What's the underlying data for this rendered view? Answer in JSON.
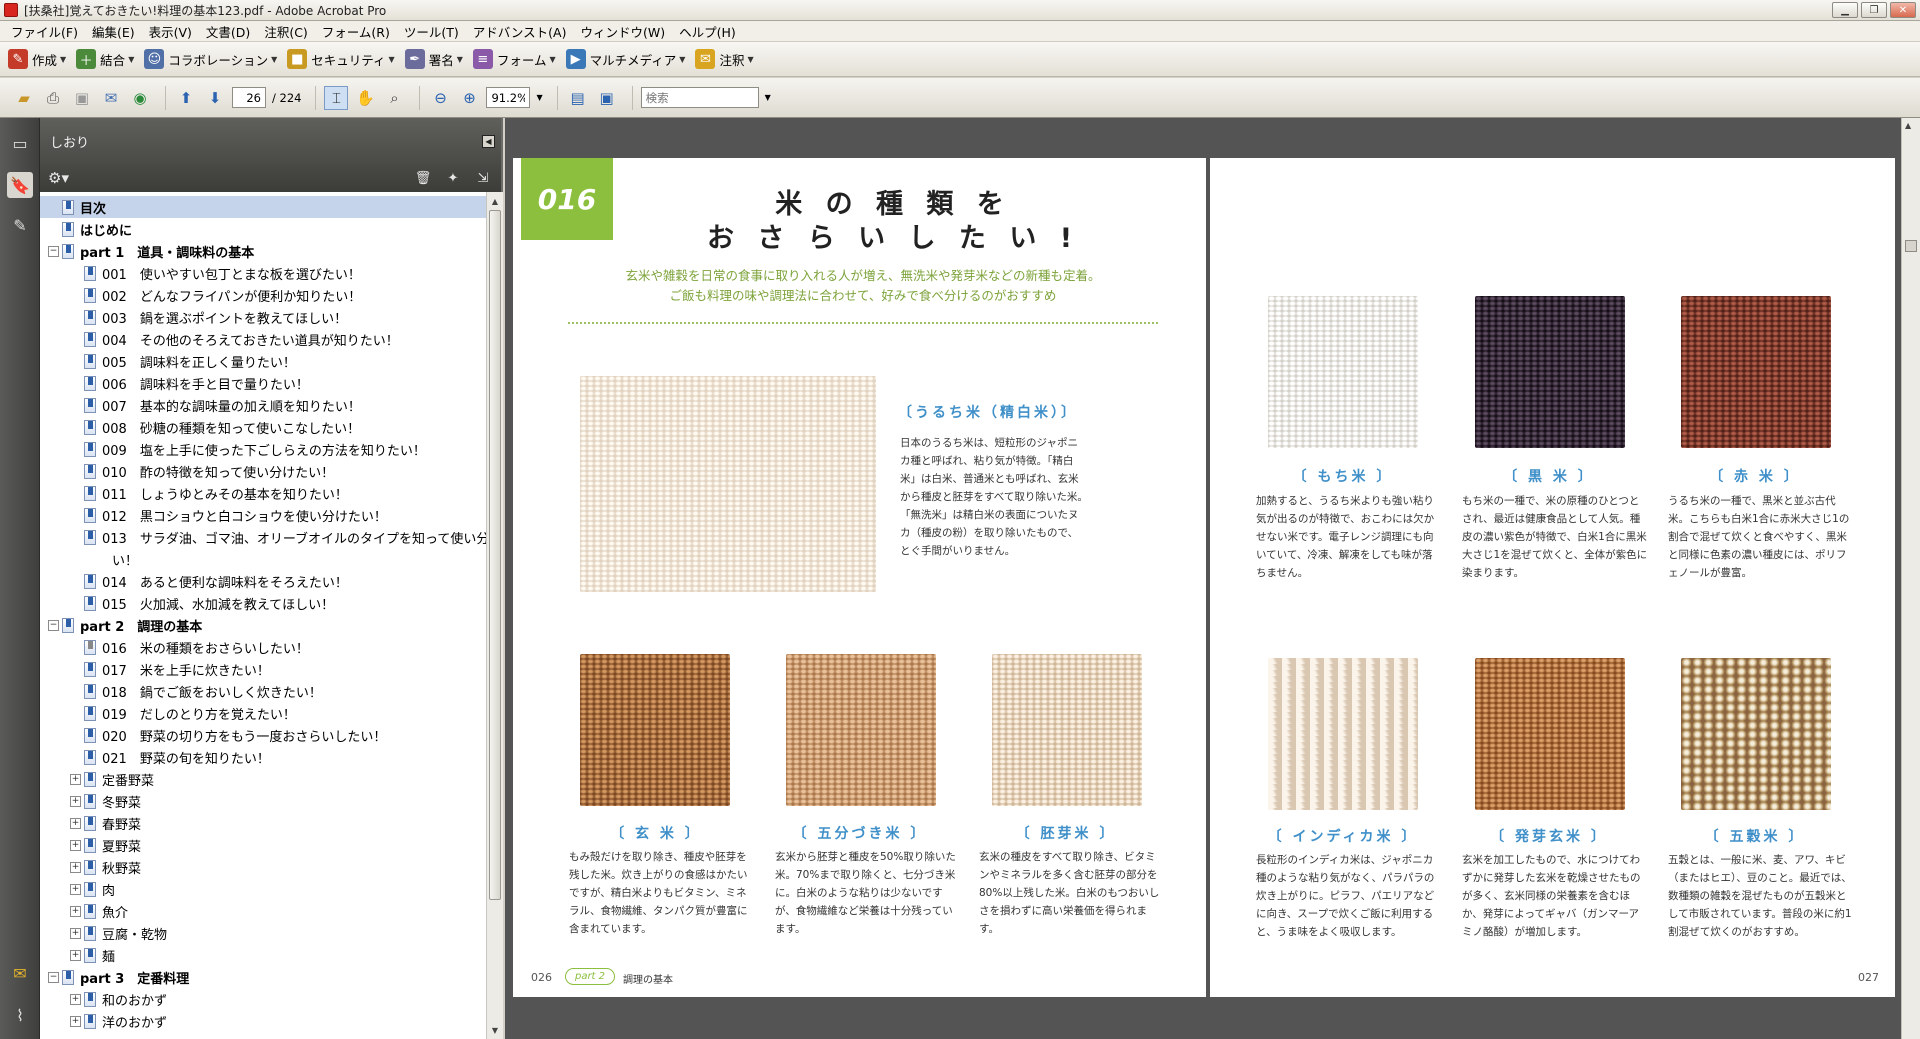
{
  "window": {
    "title": "[扶桑社]覚えておきたい!料理の基本123.pdf - Adobe Acrobat Pro"
  },
  "menu": [
    "ファイル(F)",
    "編集(E)",
    "表示(V)",
    "文書(D)",
    "注釈(C)",
    "フォーム(R)",
    "ツール(T)",
    "アドバンスト(A)",
    "ウィンドウ(W)",
    "ヘルプ(H)"
  ],
  "toolbar": {
    "create": "作成",
    "combine": "結合",
    "collab": "コラボレーション",
    "security": "セキュリティ",
    "sign": "署名",
    "forms": "フォーム",
    "multimedia": "マルチメディア",
    "comment": "注釈"
  },
  "nav": {
    "page": "26",
    "total": "/ 224",
    "zoom": "91.2%",
    "search_placeholder": "検索"
  },
  "panel": {
    "title": "しおり"
  },
  "bookmarks": [
    {
      "label": "目次",
      "level": 0,
      "bold": true,
      "sel": true
    },
    {
      "label": "はじめに",
      "level": 0,
      "bold": true
    },
    {
      "label": "part 1　道具・調味料の基本",
      "level": 0,
      "bold": true,
      "exp": "−"
    },
    {
      "label": "001　使いやすい包丁とまな板を選びたい！",
      "level": 1
    },
    {
      "label": "002　どんなフライパンが便利か知りたい！",
      "level": 1
    },
    {
      "label": "003　鍋を選ぶポイントを教えてほしい！",
      "level": 1
    },
    {
      "label": "004　その他のそろえておきたい道具が知りたい！",
      "level": 1
    },
    {
      "label": "005　調味料を正しく量りたい！",
      "level": 1
    },
    {
      "label": "006　調味料を手と目で量りたい！",
      "level": 1
    },
    {
      "label": "007　基本的な調味量の加え順を知りたい！",
      "level": 1
    },
    {
      "label": "008　砂糖の種類を知って使いこなしたい！",
      "level": 1
    },
    {
      "label": "009　塩を上手に使った下ごしらえの方法を知りたい！",
      "level": 1
    },
    {
      "label": "010　酢の特徴を知って使い分けたい！",
      "level": 1
    },
    {
      "label": "011　しょうゆとみその基本を知りたい！",
      "level": 1
    },
    {
      "label": "012　黒コショウと白コショウを使い分けたい！",
      "level": 1
    },
    {
      "label": "013　サラダ油、ゴマ油、オリーブオイルのタイプを知って使い分けた",
      "level": 1
    },
    {
      "label": "い！",
      "level": 1,
      "cont": true
    },
    {
      "label": "014　あると便利な調味料をそろえたい！",
      "level": 1
    },
    {
      "label": "015　火加減、水加減を教えてほしい！",
      "level": 1
    },
    {
      "label": "part 2　調理の基本",
      "level": 0,
      "bold": true,
      "exp": "−"
    },
    {
      "label": "016　米の種類をおさらいしたい！",
      "level": 1,
      "gray": true
    },
    {
      "label": "017　米を上手に炊きたい！",
      "level": 1
    },
    {
      "label": "018　鍋でご飯をおいしく炊きたい！",
      "level": 1
    },
    {
      "label": "019　だしのとり方を覚えたい！",
      "level": 1
    },
    {
      "label": "020　野菜の切り方をもう一度おさらいしたい！",
      "level": 1
    },
    {
      "label": "021　野菜の旬を知りたい！",
      "level": 1
    },
    {
      "label": "定番野菜",
      "level": 1,
      "exp": "+"
    },
    {
      "label": "冬野菜",
      "level": 1,
      "exp": "+"
    },
    {
      "label": "春野菜",
      "level": 1,
      "exp": "+"
    },
    {
      "label": "夏野菜",
      "level": 1,
      "exp": "+"
    },
    {
      "label": "秋野菜",
      "level": 1,
      "exp": "+"
    },
    {
      "label": "肉",
      "level": 1,
      "exp": "+"
    },
    {
      "label": "魚介",
      "level": 1,
      "exp": "+"
    },
    {
      "label": "豆腐・乾物",
      "level": 1,
      "exp": "+"
    },
    {
      "label": "麺",
      "level": 1,
      "exp": "+"
    },
    {
      "label": "part 3　定番料理",
      "level": 0,
      "bold": true,
      "exp": "−"
    },
    {
      "label": "和のおかず",
      "level": 1,
      "exp": "+"
    },
    {
      "label": "洋のおかず",
      "level": 1,
      "exp": "+"
    }
  ],
  "pageLeft": {
    "badge": "016",
    "title1": "米 の 種 類 を",
    "title2": "お さ ら い し た い !",
    "sub1": "玄米や雑穀を日常の食事に取り入れる人が増え、無洗米や発芽米などの新種も定着。",
    "sub2": "ご飯も料理の味や調理法に合わせて、好みで食べ分けるのがおすすめ",
    "uruchi_name": "〔うるち米（精白米）〕",
    "uruchi_desc": "日本のうるち米は、短粒形のジャポニカ種と呼ばれ、粘り気が特徴。「精白米」は白米、普通米とも呼ばれ、玄米から種皮と胚芽をすべて取り除いた米。「無洗米」は精白米の表面についたヌカ（種皮の粉）を取り除いたもので、とぐ手間がいりません。",
    "genmai_name": "〔 玄 米 〕",
    "genmai_desc": "もみ殻だけを取り除き、種皮や胚芽を残した米。炊き上がりの食感はかたいですが、精白米よりもビタミン、ミネラル、食物繊維、タンパク質が豊富に含まれています。",
    "gobu_name": "〔 五分づき米 〕",
    "gobu_desc": "玄米から胚芽と種皮を50%取り除いた米。70%まで取り除くと、七分づき米に。白米のような粘りは少ないですが、食物繊維など栄養は十分残っています。",
    "haiga_name": "〔 胚芽米 〕",
    "haiga_desc": "玄米の種皮をすべて取り除き、ビタミンやミネラルを多く含む胚芽の部分を80%以上残した米。白米のもつおいしさを損わずに高い栄養価を得られます。",
    "pageno": "026",
    "part": "part 2",
    "section": "調理の基本"
  },
  "pageRight": {
    "mochi_name": "〔 もち米 〕",
    "mochi_desc": "加熱すると、うるち米よりも強い粘り気が出るのが特徴で、おこわには欠かせない米です。電子レンジ調理にも向いていて、冷凍、解凍をしても味が落ちません。",
    "kuro_name": "〔 黒 米 〕",
    "kuro_desc": "もち米の一種で、米の原種のひとつとされ、最近は健康食品として人気。種皮の濃い紫色が特徴で、白米1合に黒米大さじ1を混ぜて炊くと、全体が紫色に染まります。",
    "aka_name": "〔 赤 米 〕",
    "aka_desc": "うるち米の一種で、黒米と並ぶ古代米。こちらも白米1合に赤米大さじ1の割合で混ぜて炊くと食べやすく、黒米と同様に色素の濃い種皮には、ポリフェノールが豊富。",
    "indica_name": "〔 インディカ米 〕",
    "indica_desc": "長粒形のインディカ米は、ジャポニカ種のような粘り気がなく、パラパラの炊き上がりに。ピラフ、パエリアなどに向き、スープで炊くご飯に利用すると、うま味をよく吸収します。",
    "hatsuga_name": "〔 発芽玄米 〕",
    "hatsuga_desc": "玄米を加工したもので、水につけてわずかに発芽した玄米を乾燥させたものが多く、玄米同様の栄養素を含むほか、発芽によってギャバ（ガンマーアミノ酪酸）が増加します。",
    "gokoku_name": "〔 五穀米 〕",
    "gokoku_desc": "五穀とは、一般に米、麦、アワ、キビ（またはヒエ）、豆のこと。最近では、数種類の雑穀を混ぜたものが五穀米として市販されています。普段の米に約1割混ぜて炊くのがおすすめ。",
    "pageno": "027"
  }
}
